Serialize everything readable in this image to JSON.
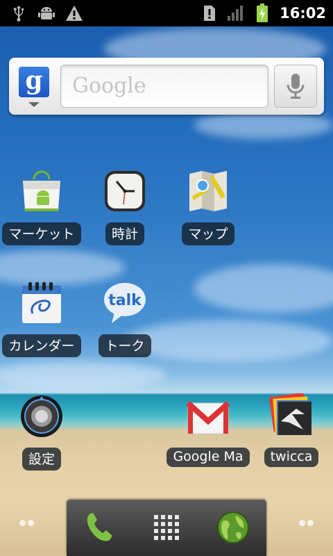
{
  "status_bar": {
    "time": "16:02",
    "icons_left": [
      "usb-icon",
      "android-debug-icon",
      "warning-icon"
    ],
    "icons_right": [
      "sim-alert-icon",
      "signal-icon",
      "battery-charging-icon"
    ]
  },
  "search_widget": {
    "placeholder": "Google",
    "logo_letter": "g"
  },
  "apps": [
    {
      "label": "マーケット",
      "icon": "market-icon"
    },
    {
      "label": "時計",
      "icon": "clock-icon"
    },
    {
      "label": "マップ",
      "icon": "maps-icon"
    },
    {
      "label": "カレンダー",
      "icon": "calendar-icon"
    },
    {
      "label": "トーク",
      "icon": "talk-icon",
      "icon_text": "talk"
    },
    {
      "label": "設定",
      "icon": "settings-icon"
    },
    {
      "label": "Google Ma",
      "icon": "gmail-icon"
    },
    {
      "label": "twicca",
      "icon": "twicca-icon"
    }
  ],
  "dock": {
    "items": [
      "phone-icon",
      "app-drawer-icon",
      "browser-icon"
    ]
  },
  "colors": {
    "status_bar_bg": "#000000",
    "label_bg": "#141e28",
    "battery": "#9bd34a"
  }
}
